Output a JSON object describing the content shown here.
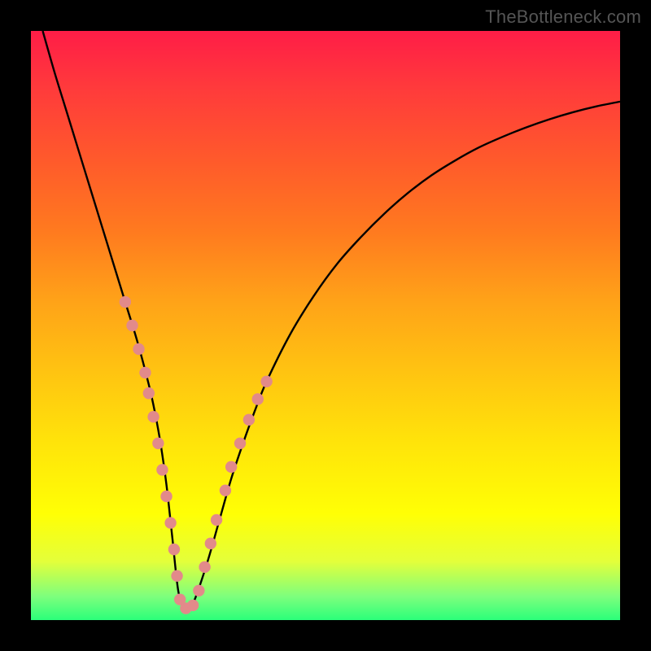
{
  "watermark": "TheBottleneck.com",
  "colors": {
    "curve_stroke": "#000000",
    "marker_fill": "#e28a8a",
    "marker_stroke": "#c97272",
    "frame_bg": "#000000"
  },
  "chart_data": {
    "type": "line",
    "title": "",
    "xlabel": "",
    "ylabel": "",
    "xlim": [
      0,
      100
    ],
    "ylim": [
      0,
      100
    ],
    "grid": false,
    "legend": false,
    "series": [
      {
        "name": "bottleneck-curve",
        "x": [
          2,
          4,
          6,
          8,
          10,
          12,
          14,
          16,
          18,
          20,
          21,
          22,
          23,
          24,
          25,
          26,
          27,
          28,
          30,
          32,
          34,
          36,
          38,
          40,
          44,
          48,
          52,
          56,
          60,
          64,
          68,
          72,
          76,
          80,
          84,
          88,
          92,
          96,
          100
        ],
        "y": [
          100,
          93,
          86.5,
          80,
          73.5,
          67,
          60.5,
          54,
          47.5,
          40,
          35.5,
          30,
          23,
          14,
          5,
          2,
          2,
          4,
          10,
          17,
          24,
          30,
          35.5,
          40.5,
          48.5,
          55,
          60.5,
          65,
          69,
          72.5,
          75.5,
          78,
          80.2,
          82,
          83.6,
          85,
          86.2,
          87.2,
          88
        ]
      }
    ],
    "markers": [
      {
        "x": 16.0,
        "y": 54.0
      },
      {
        "x": 17.2,
        "y": 50.0
      },
      {
        "x": 18.3,
        "y": 46.0
      },
      {
        "x": 19.4,
        "y": 42.0
      },
      {
        "x": 20.0,
        "y": 38.5
      },
      {
        "x": 20.8,
        "y": 34.5
      },
      {
        "x": 21.6,
        "y": 30.0
      },
      {
        "x": 22.3,
        "y": 25.5
      },
      {
        "x": 23.0,
        "y": 21.0
      },
      {
        "x": 23.7,
        "y": 16.5
      },
      {
        "x": 24.3,
        "y": 12.0
      },
      {
        "x": 24.8,
        "y": 7.5
      },
      {
        "x": 25.3,
        "y": 3.5
      },
      {
        "x": 26.3,
        "y": 2.0
      },
      {
        "x": 27.5,
        "y": 2.5
      },
      {
        "x": 28.5,
        "y": 5.0
      },
      {
        "x": 29.5,
        "y": 9.0
      },
      {
        "x": 30.5,
        "y": 13.0
      },
      {
        "x": 31.5,
        "y": 17.0
      },
      {
        "x": 33.0,
        "y": 22.0
      },
      {
        "x": 34.0,
        "y": 26.0
      },
      {
        "x": 35.5,
        "y": 30.0
      },
      {
        "x": 37.0,
        "y": 34.0
      },
      {
        "x": 38.5,
        "y": 37.5
      },
      {
        "x": 40.0,
        "y": 40.5
      }
    ]
  }
}
